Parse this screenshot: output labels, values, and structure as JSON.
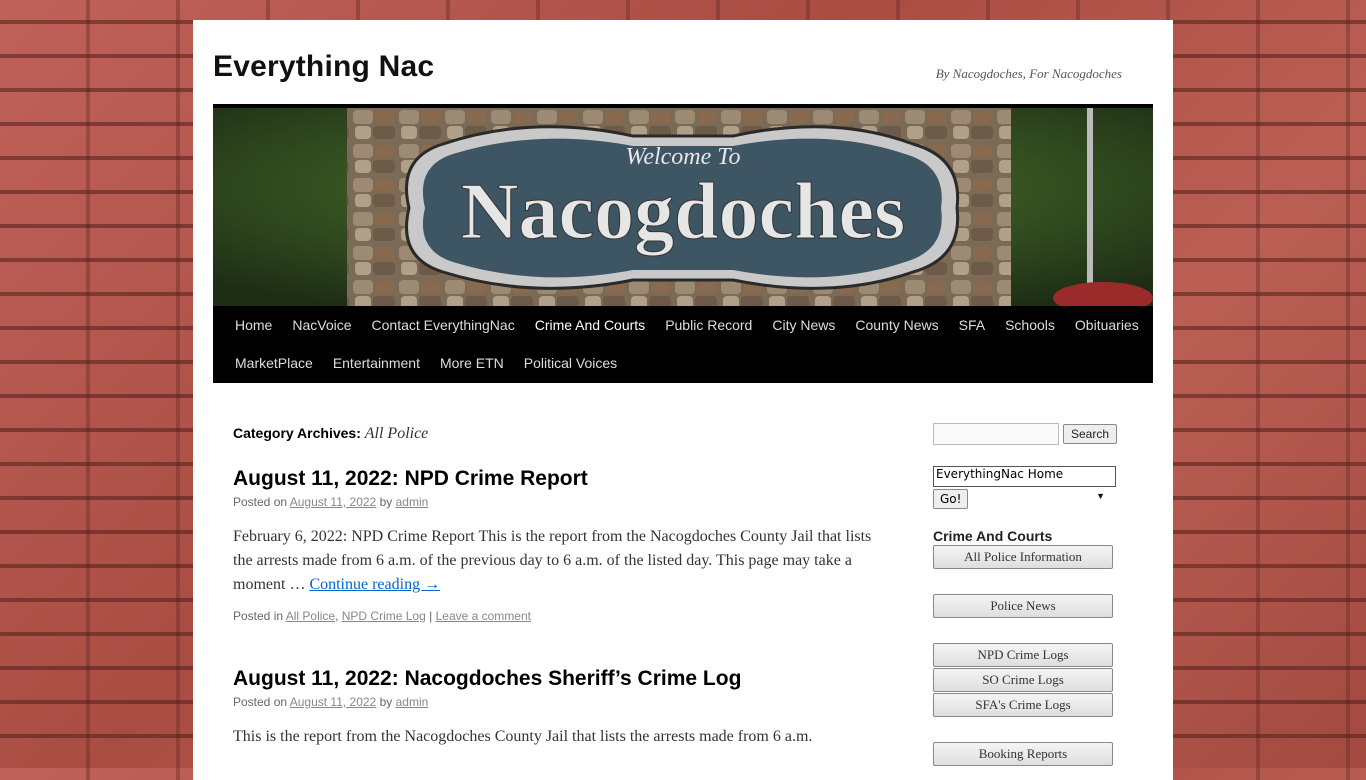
{
  "site": {
    "title": "Everything Nac",
    "description": "By Nacogdoches, For Nacogdoches",
    "header_image": {
      "line1": "Welcome To",
      "line2": "Nacogdoches"
    }
  },
  "nav": {
    "items": [
      "Home",
      "NacVoice",
      "Contact EverythingNac",
      "Crime And Courts",
      "Public Record",
      "City News",
      "County News",
      "SFA",
      "Schools",
      "Obituaries",
      "MarketPlace",
      "Entertainment",
      "More ETN",
      "Political Voices"
    ],
    "current": "Crime And Courts"
  },
  "archive": {
    "prefix": "Category Archives:",
    "name": "All Police"
  },
  "posts": [
    {
      "title": "August 11, 2022: NPD Crime Report",
      "posted_on": "Posted on",
      "date": "August 11, 2022",
      "by": "by",
      "author": "admin",
      "summary": "February 6, 2022: NPD Crime Report This is the report from the Nacogdoches County Jail that lists the arrests made from 6 a.m. of the previous day to 6 a.m. of the listed day. This page may take a moment …",
      "continue": "Continue reading →",
      "posted_in": "Posted in",
      "categories": [
        "All Police",
        "NPD Crime Log"
      ],
      "comment_link": "Leave a comment"
    },
    {
      "title": "August 11, 2022: Nacogdoches Sheriff’s Crime Log",
      "posted_on": "Posted on",
      "date": "August 11, 2022",
      "by": "by",
      "author": "admin",
      "summary": "This is the report from the Nacogdoches County Jail that lists the arrests made from 6 a.m."
    }
  ],
  "sidebar": {
    "search_button": "Search",
    "select_value": "EverythingNac Home",
    "go_button": "Go!",
    "widget_title": "Crime And Courts",
    "buttons": [
      "All Police Information",
      "Police News",
      "NPD Crime Logs",
      "SO Crime Logs",
      "SFA's Crime Logs",
      "Booking Reports"
    ]
  }
}
